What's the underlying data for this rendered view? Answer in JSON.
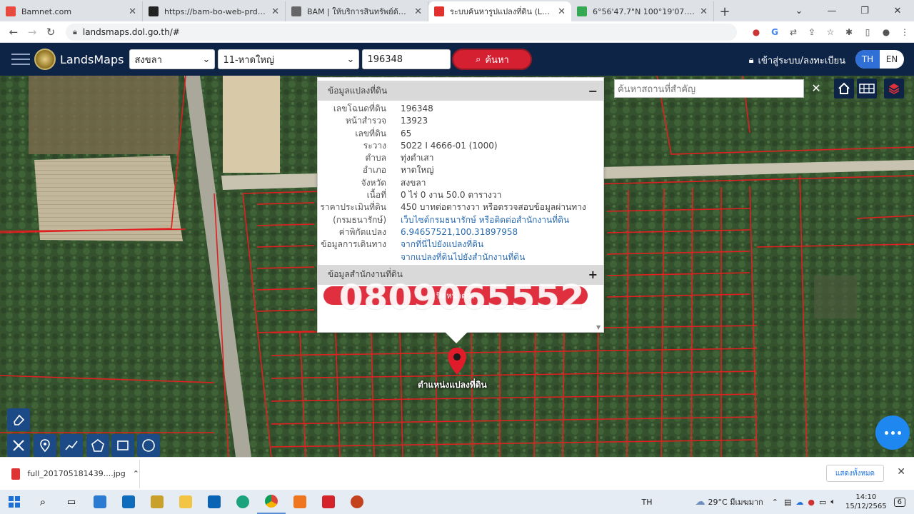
{
  "browser": {
    "tabs": [
      {
        "title": "Bamnet.com",
        "fav": "#e94a3f",
        "active": false
      },
      {
        "title": "https://bam-bo-web-prd.bam.co.th",
        "fav": "#222222",
        "active": false
      },
      {
        "title": "BAM | ให้บริการสินทรัพย์ด้านอสังหาริมทรัพย์",
        "fav": "#666666",
        "active": false
      },
      {
        "title": "ระบบค้นหารูปแปลงที่ดิน (LandsMaps)",
        "fav": "#e0302f",
        "active": true
      },
      {
        "title": "6°56'47.7\"N 100°19'07.7\"E - Google Maps",
        "fav": "#34a853",
        "active": false
      }
    ],
    "url": "landsmaps.dol.go.th/#"
  },
  "header": {
    "brand": "LandsMaps",
    "province": "สงขลา",
    "district": "11-หาดใหญ่",
    "deed_no": "196348",
    "search_label": "ค้นหา",
    "login_label": "เข้าสู่ระบบ/ลงทะเบียน",
    "lang_th": "TH",
    "lang_en": "EN"
  },
  "map": {
    "place_search_placeholder": "ค้นหาสถานที่สำคัญ",
    "pin_label": "ตำแหน่งแปลงที่ดิน"
  },
  "popup": {
    "section1_title": "ข้อมูลแปลงที่ดิน",
    "section1_toggle": "−",
    "rows": [
      {
        "k": "เลขโฉนดที่ดิน",
        "v": "196348",
        "link": false
      },
      {
        "k": "หน้าสำรวจ",
        "v": "13923",
        "link": false
      },
      {
        "k": "เลขที่ดิน",
        "v": "65",
        "link": false
      },
      {
        "k": "ระวาง",
        "v": "5022 I 4666-01 (1000)",
        "link": false
      },
      {
        "k": "ตำบล",
        "v": "ทุ่งตำเสา",
        "link": false
      },
      {
        "k": "อำเภอ",
        "v": "หาดใหญ่",
        "link": false
      },
      {
        "k": "จังหวัด",
        "v": "สงขลา",
        "link": false
      },
      {
        "k": "เนื้อที่",
        "v": "0 ไร่ 0 งาน 50.0 ตารางวา",
        "link": false
      },
      {
        "k": "ราคาประเมินที่ดิน",
        "v": "450 บาทต่อตารางวา หรือตรวจสอบข้อมูลผ่านทาง",
        "link": false
      },
      {
        "k": "(กรมธนารักษ์)",
        "v": "เว็บไซต์กรมธนารักษ์ หรือติดต่อสำนักงานที่ดิน",
        "link": true
      },
      {
        "k": "ค่าพิกัดแปลง",
        "v": "6.94657521,100.31897958",
        "link": true
      },
      {
        "k": "ข้อมูลการเดินทาง",
        "v": "จากที่นี่ไปยังแปลงที่ดิน",
        "link": true
      },
      {
        "k": "",
        "v": "จากแปลงที่ดินไปยังสำนักงานที่ดิน",
        "link": true
      }
    ],
    "section2_title": "ข้อมูลสำนักงานที่ดิน",
    "section2_toggle": "+",
    "button_label": "ปิดหน้าต่าง",
    "watermark_phone": "0809065552"
  },
  "downloads": {
    "file": "full_201705181439....jpg",
    "show_all": "แสดงทั้งหมด"
  },
  "taskbar": {
    "lang": "TH",
    "weather": "29°C มีเมฆมาก",
    "time": "14:10",
    "date": "15/12/2565",
    "notif": "6"
  }
}
